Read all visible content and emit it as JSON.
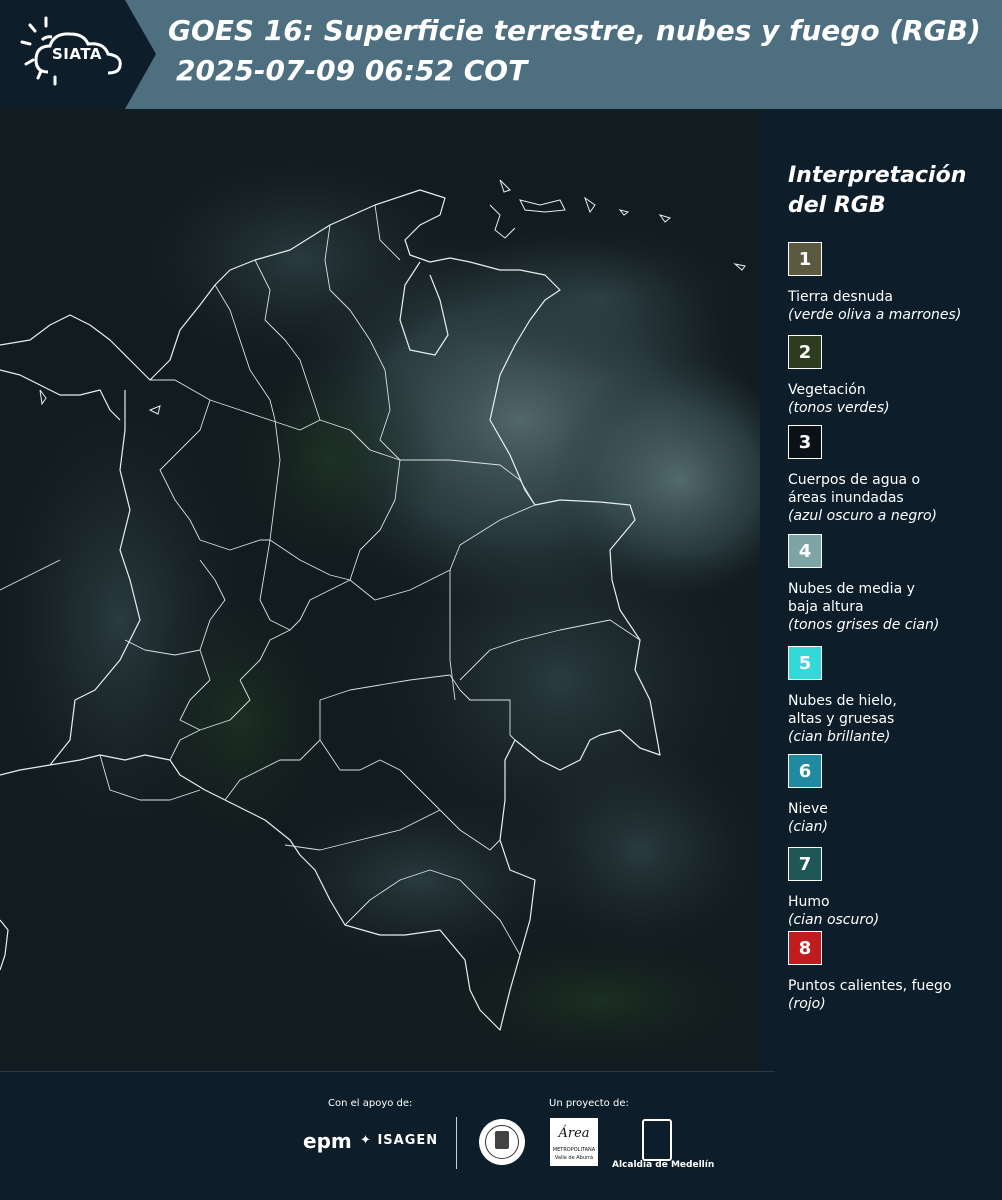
{
  "header": {
    "logo_text": "SIATA",
    "title_line1": "GOES 16: Superficie terrestre, nubes y fuego (RGB)",
    "title_line2": "2025-07-09 06:52 COT"
  },
  "legend": {
    "title_line1": "Interpretación",
    "title_line2": "del RGB",
    "items": [
      {
        "num": "1",
        "color": "#5b5a40",
        "label_lines": [
          "Tierra desnuda"
        ],
        "note": "(verde oliva a marrones)"
      },
      {
        "num": "2",
        "color": "#2d3b1e",
        "label_lines": [
          "Vegetación"
        ],
        "note": "(tonos verdes)"
      },
      {
        "num": "3",
        "color": "#0b1217",
        "label_lines": [
          "Cuerpos de agua o",
          "áreas inundadas"
        ],
        "note": "(azul oscuro a negro)"
      },
      {
        "num": "4",
        "color": "#7ea5a6",
        "label_lines": [
          "Nubes de media y",
          "baja altura"
        ],
        "note": "(tonos grises de cian)"
      },
      {
        "num": "5",
        "color": "#35d8d8",
        "label_lines": [
          "Nubes de hielo,",
          "altas y gruesas"
        ],
        "note": "(cian brillante)"
      },
      {
        "num": "6",
        "color": "#1f8aa0",
        "label_lines": [
          "Nieve"
        ],
        "note": "(cian)"
      },
      {
        "num": "7",
        "color": "#1f5656",
        "label_lines": [
          "Humo"
        ],
        "note": "(cian oscuro)"
      },
      {
        "num": "8",
        "color": "#c01b1f",
        "label_lines": [
          "Puntos calientes, fuego"
        ],
        "note": "(rojo)"
      }
    ]
  },
  "footer": {
    "support_label": "Con el apoyo de:",
    "project_label": "Un proyecto de:",
    "epm_text": "epm",
    "isagen_text": "ISAGEN",
    "area_text": "Área",
    "area_sub": "METROPOLITANA",
    "area_sub2": "Valle de Aburrá",
    "alcaldia_text": "Alcaldía de Medellín"
  }
}
